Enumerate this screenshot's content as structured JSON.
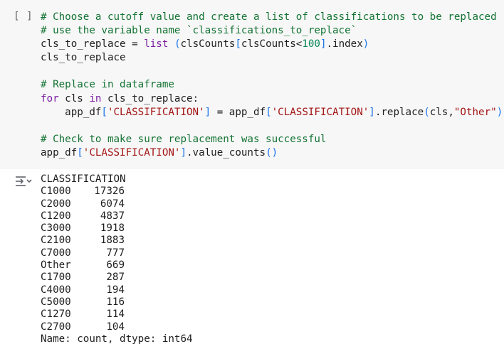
{
  "cell": {
    "run_indicator": "[ ]",
    "code_lines": [
      [
        {
          "t": "# Choose a cutoff value and create a list of classifications to be replaced",
          "c": "c-comment"
        }
      ],
      [
        {
          "t": "# use the variable name `classifications_to_replace`",
          "c": "c-comment"
        }
      ],
      [
        {
          "t": "cls_to_replace = ",
          "c": "c-plain"
        },
        {
          "t": "list",
          "c": "c-kw"
        },
        {
          "t": " ",
          "c": "c-plain"
        },
        {
          "t": "(",
          "c": "c-paren"
        },
        {
          "t": "clsCounts",
          "c": "c-plain"
        },
        {
          "t": "[",
          "c": "c-paren"
        },
        {
          "t": "clsCounts<",
          "c": "c-plain"
        },
        {
          "t": "100",
          "c": "c-num"
        },
        {
          "t": "]",
          "c": "c-paren"
        },
        {
          "t": ".index",
          "c": "c-plain"
        },
        {
          "t": ")",
          "c": "c-paren"
        }
      ],
      [
        {
          "t": "cls_to_replace",
          "c": "c-plain"
        }
      ],
      [
        {
          "t": "",
          "c": "c-plain"
        }
      ],
      [
        {
          "t": "# Replace in dataframe",
          "c": "c-comment"
        }
      ],
      [
        {
          "t": "for",
          "c": "c-kw"
        },
        {
          "t": " cls ",
          "c": "c-plain"
        },
        {
          "t": "in",
          "c": "c-kw"
        },
        {
          "t": " cls_to_replace:",
          "c": "c-plain"
        }
      ],
      [
        {
          "t": "    app_df",
          "c": "c-plain"
        },
        {
          "t": "[",
          "c": "c-paren"
        },
        {
          "t": "'CLASSIFICATION'",
          "c": "c-str"
        },
        {
          "t": "]",
          "c": "c-paren"
        },
        {
          "t": " = app_df",
          "c": "c-plain"
        },
        {
          "t": "[",
          "c": "c-paren"
        },
        {
          "t": "'CLASSIFICATION'",
          "c": "c-str"
        },
        {
          "t": "]",
          "c": "c-paren"
        },
        {
          "t": ".replace",
          "c": "c-plain"
        },
        {
          "t": "(",
          "c": "c-paren"
        },
        {
          "t": "cls,",
          "c": "c-plain"
        },
        {
          "t": "\"Other\"",
          "c": "c-str"
        },
        {
          "t": ")",
          "c": "c-paren"
        }
      ],
      [
        {
          "t": "",
          "c": "c-plain"
        }
      ],
      [
        {
          "t": "# Check to make sure replacement was successful",
          "c": "c-comment"
        }
      ],
      [
        {
          "t": "app_df",
          "c": "c-plain"
        },
        {
          "t": "[",
          "c": "c-paren"
        },
        {
          "t": "'CLASSIFICATION'",
          "c": "c-str"
        },
        {
          "t": "]",
          "c": "c-paren"
        },
        {
          "t": ".value_counts",
          "c": "c-plain"
        },
        {
          "t": "()",
          "c": "c-paren"
        }
      ]
    ]
  },
  "output": {
    "toggle_icon": "output-toggle-icon",
    "header": "CLASSIFICATION",
    "rows": [
      {
        "index": "C1000",
        "value": "17326"
      },
      {
        "index": "C2000",
        "value": "6074"
      },
      {
        "index": "C1200",
        "value": "4837"
      },
      {
        "index": "C3000",
        "value": "1918"
      },
      {
        "index": "C2100",
        "value": "1883"
      },
      {
        "index": "C7000",
        "value": "777"
      },
      {
        "index": "Other",
        "value": "669"
      },
      {
        "index": "C1700",
        "value": "287"
      },
      {
        "index": "C4000",
        "value": "194"
      },
      {
        "index": "C5000",
        "value": "116"
      },
      {
        "index": "C1270",
        "value": "114"
      },
      {
        "index": "C2700",
        "value": "104"
      }
    ],
    "footer": "Name: count, dtype: int64"
  },
  "colors": {
    "cell_background": "#f7f7f7",
    "comment": "#137333",
    "keyword": "#7b1fa2",
    "string": "#a31515",
    "number": "#098658",
    "bracket": "#1a73e8"
  }
}
